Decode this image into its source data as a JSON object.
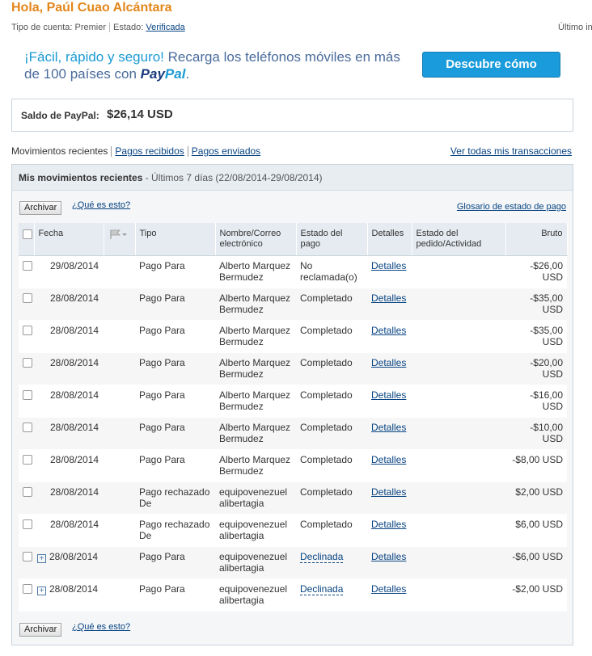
{
  "header": {
    "greeting": "Hola, Paúl Cuao Alcántara",
    "account_type_label": "Tipo de cuenta:",
    "account_type": "Premier",
    "status_label": "Estado:",
    "status": "Verificada",
    "last_login": "Último inic"
  },
  "promo": {
    "highlight": "¡Fácil, rápido y seguro!",
    "text": " Recarga los teléfonos móviles en más de 100 países con ",
    "brand_pay": "Pay",
    "brand_pal": "Pal",
    "end": ".",
    "button": "Descubre cómo"
  },
  "balance": {
    "label": "Saldo de PayPal:",
    "amount": "$26,14 USD"
  },
  "tabs": {
    "current": "Movimientos recientes",
    "received": "Pagos recibidos",
    "sent": "Pagos enviados",
    "view_all": "Ver todas mis transacciones"
  },
  "panel": {
    "title": "Mis movimientos recientes",
    "range": " - Últimos 7 días (22/08/2014-29/08/2014)",
    "archive": "Archivar",
    "whats_this": "¿Qué es esto?",
    "glossary": "Glosario de estado de pago"
  },
  "columns": [
    "Fecha",
    "Tipo",
    "Nombre/Correo electrónico",
    "Estado del pago",
    "Detalles",
    "Estado del pedido/Actividad",
    "Bruto"
  ],
  "rows": [
    {
      "date": "29/08/2014",
      "type": "Pago Para",
      "name": "Alberto Marquez Bermudez",
      "status": "No reclamada(o)",
      "details": "Detalles",
      "amount": "-$26,00 USD"
    },
    {
      "date": "28/08/2014",
      "type": "Pago Para",
      "name": "Alberto Marquez Bermudez",
      "status": "Completado",
      "details": "Detalles",
      "amount": "-$35,00 USD"
    },
    {
      "date": "28/08/2014",
      "type": "Pago Para",
      "name": "Alberto Marquez Bermudez",
      "status": "Completado",
      "details": "Detalles",
      "amount": "-$35,00 USD"
    },
    {
      "date": "28/08/2014",
      "type": "Pago Para",
      "name": "Alberto Marquez Bermudez",
      "status": "Completado",
      "details": "Detalles",
      "amount": "-$20,00 USD"
    },
    {
      "date": "28/08/2014",
      "type": "Pago Para",
      "name": "Alberto Marquez Bermudez",
      "status": "Completado",
      "details": "Detalles",
      "amount": "-$16,00 USD"
    },
    {
      "date": "28/08/2014",
      "type": "Pago Para",
      "name": "Alberto Marquez Bermudez",
      "status": "Completado",
      "details": "Detalles",
      "amount": "-$10,00 USD"
    },
    {
      "date": "28/08/2014",
      "type": "Pago Para",
      "name": "Alberto Marquez Bermudez",
      "status": "Completado",
      "details": "Detalles",
      "amount": "-$8,00 USD"
    },
    {
      "date": "28/08/2014",
      "type": "Pago rechazado De",
      "name": "equipovenezuel alibertagia",
      "status": "Completado",
      "details": "Detalles",
      "amount": "$2,00 USD"
    },
    {
      "date": "28/08/2014",
      "type": "Pago rechazado De",
      "name": "equipovenezuel alibertagia",
      "status": "Completado",
      "details": "Detalles",
      "amount": "$6,00 USD"
    },
    {
      "date": "28/08/2014",
      "type": "Pago Para",
      "name": "equipovenezuel alibertagia",
      "status": "Declinada",
      "details": "Detalles",
      "amount": "-$6,00 USD",
      "expandable": true,
      "status_link": true
    },
    {
      "date": "28/08/2014",
      "type": "Pago Para",
      "name": "equipovenezuel alibertagia",
      "status": "Declinada",
      "details": "Detalles",
      "amount": "-$2,00 USD",
      "expandable": true,
      "status_link": true
    }
  ]
}
